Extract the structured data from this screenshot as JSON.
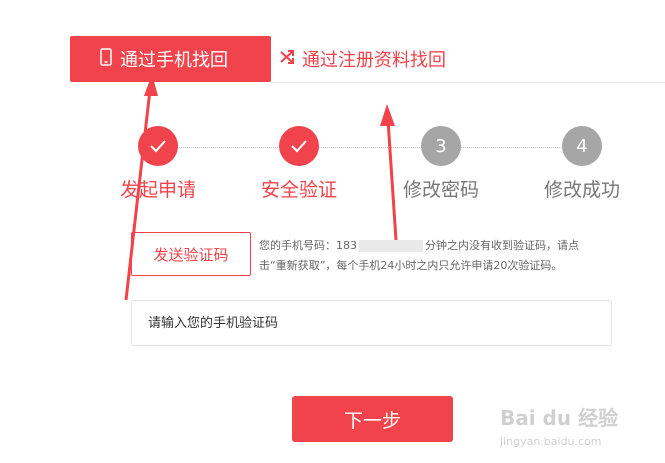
{
  "tabs": [
    {
      "label": "通过手机找回",
      "icon": "phone-icon",
      "active": true
    },
    {
      "label": "通过注册资料找回",
      "icon": "shuffle-icon",
      "active": false
    }
  ],
  "steps": [
    {
      "number": "",
      "label": "发起申请",
      "status": "done"
    },
    {
      "number": "",
      "label": "安全验证",
      "status": "done"
    },
    {
      "number": "3",
      "label": "修改密码",
      "status": "todo"
    },
    {
      "number": "4",
      "label": "修改成功",
      "status": "todo"
    }
  ],
  "send_code_button": "发送验证码",
  "info": {
    "phone_prefix": "您的手机号码：183",
    "line1_rest": "分钟之内没有收到验证码，请点",
    "line2": "击“重新获取”，每个手机24小时之内只允许申请20次验证码。"
  },
  "code_input": {
    "placeholder": "请输入您的手机验证码",
    "value": ""
  },
  "next_button": "下一步",
  "watermark": {
    "main": "Bai du 经验",
    "sub": "jingyan.baidu.com"
  },
  "colors": {
    "accent": "#f0434b",
    "inactive_step": "#a6a6a6"
  }
}
